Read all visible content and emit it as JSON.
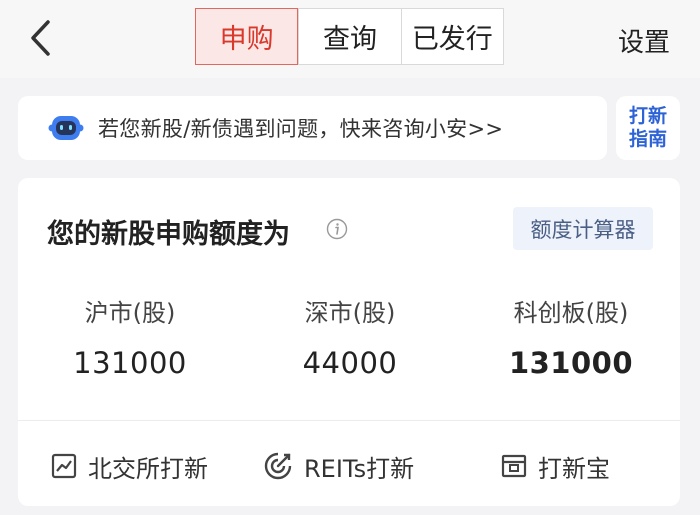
{
  "header": {
    "back_icon": "chevron-left-icon",
    "tabs": [
      {
        "label": "申购",
        "active": true
      },
      {
        "label": "查询",
        "active": false
      },
      {
        "label": "已发行",
        "active": false
      }
    ],
    "settings_label": "设置",
    "accent_color": "#d9382b"
  },
  "banner": {
    "icon": "robot-icon",
    "text": "若您新股/新债遇到问题，快来咨询小安>>",
    "guide_line1": "打新",
    "guide_line2": "指南"
  },
  "quota": {
    "title": "您的新股申购额度为",
    "info_icon": "info-icon",
    "calculator_label": "额度计算器",
    "markets": [
      {
        "label": "沪市(股)",
        "value": "131000"
      },
      {
        "label": "深市(股)",
        "value": "44000"
      },
      {
        "label": "科创板(股)",
        "value": "131000"
      }
    ]
  },
  "actions": [
    {
      "label": "北交所打新",
      "icon": "chart-icon"
    },
    {
      "label": "REITs打新",
      "icon": "target-icon"
    },
    {
      "label": "打新宝",
      "icon": "box-icon"
    }
  ]
}
